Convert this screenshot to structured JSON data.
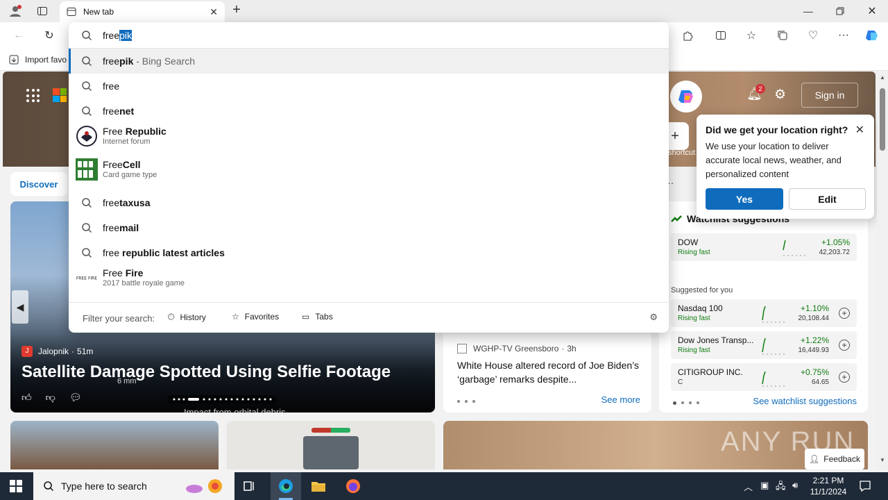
{
  "browser": {
    "tab_title": "New tab",
    "favorites_item": "Import favo"
  },
  "omnibox": {
    "query_typed": "free",
    "query_autocomplete": "pik",
    "suggestions": [
      {
        "prefix": "free",
        "bold": "pik",
        "sub": " - Bing Search",
        "active": true
      },
      {
        "prefix": "free",
        "bold": "",
        "sub": ""
      },
      {
        "prefix": "free",
        "bold": "net",
        "sub": ""
      },
      {
        "prefix": "Free ",
        "bold": "Republic",
        "desc": "Internet forum"
      },
      {
        "prefix": "Free",
        "bold": "Cell",
        "desc": "Card game type"
      },
      {
        "prefix": "free",
        "bold": "taxusa",
        "sub": ""
      },
      {
        "prefix": "free",
        "bold": "mail",
        "sub": ""
      },
      {
        "prefix": "free ",
        "bold": "republic latest articles",
        "sub": ""
      },
      {
        "prefix": "Free ",
        "bold": "Fire",
        "desc": "2017 battle royale game"
      }
    ],
    "filter_label": "Filter your search:",
    "filter_history": "History",
    "filter_favorites": "Favorites",
    "filter_tabs": "Tabs"
  },
  "page": {
    "discover_label": "Discover",
    "sign_in": "Sign in",
    "notification_count": "2",
    "shortcut_partial": "shortcut",
    "hero": {
      "source": "Jalopnik",
      "age": "51m",
      "title": "Satellite Damage Spotted Using Selfie Footage",
      "caption_a": "6 mm",
      "caption_b": "Impact from orbital debris"
    },
    "news": {
      "source": "WGHP-TV Greensboro",
      "age": "3h",
      "title": "White House altered record of Joe Biden’s ‘garbage’ remarks despite...",
      "see_more": "See more"
    },
    "watchlist": {
      "title": "Watchlist suggestions",
      "suggested_label": "Suggested for you",
      "see_link": "See watchlist suggestions",
      "stocks": [
        {
          "name": "DOW",
          "status": "Rising fast",
          "change": "+1.05%",
          "price": "42,203.72",
          "addable": false
        },
        {
          "name": "Nasdaq 100",
          "status": "Rising fast",
          "change": "+1.10%",
          "price": "20,108.44",
          "addable": true
        },
        {
          "name": "Dow Jones Transp...",
          "status": "Rising fast",
          "change": "+1.22%",
          "price": "16,449.93",
          "addable": true
        },
        {
          "name": "CITIGROUP INC.",
          "status": "C",
          "change": "+0.75%",
          "price": "64.65",
          "addable": true
        }
      ]
    },
    "feedback": "Feedback",
    "watermark": "ANY RUN"
  },
  "location_popup": {
    "title": "Did we get your location right?",
    "body": "We use your location to deliver accurate local news, weather, and personalized content",
    "yes": "Yes",
    "edit": "Edit"
  },
  "taskbar": {
    "search_placeholder": "Type here to search",
    "time": "2:21 PM",
    "date": "11/1/2024"
  },
  "colors": {
    "accent": "#0f6cbd",
    "stock_green": "#107c10",
    "taskbar": "#1f2a38"
  }
}
